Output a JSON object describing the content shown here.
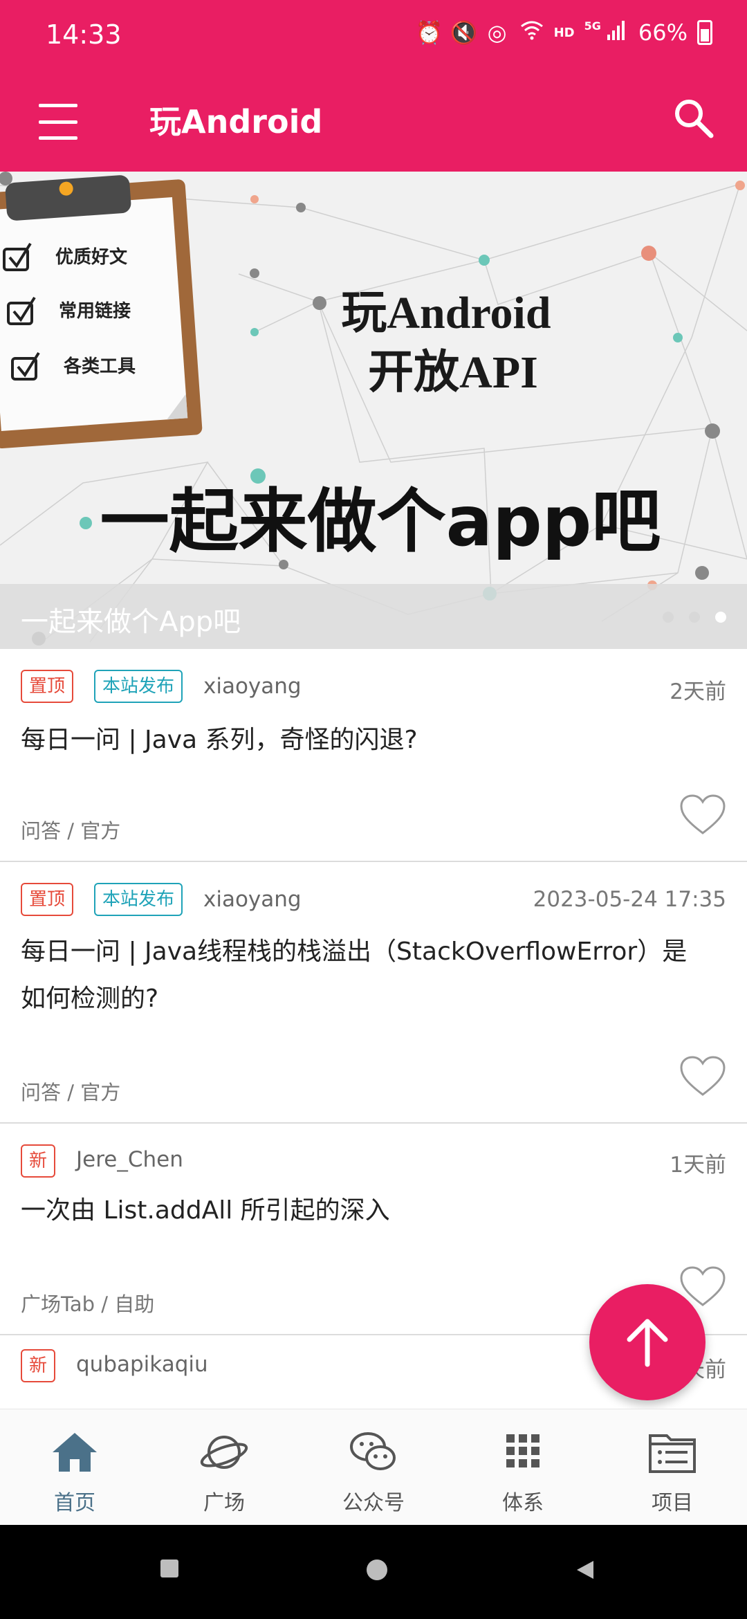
{
  "status_bar": {
    "time": "14:33",
    "battery": "66%",
    "network": "5G",
    "hd_label": "HD",
    "icons": [
      "alarm-icon",
      "mute-icon",
      "hotspot-icon",
      "wifi-icon",
      "signal-icon",
      "battery-icon"
    ]
  },
  "app_bar": {
    "title": "玩Android",
    "menu_icon": "menu-icon",
    "search_icon": "search-icon"
  },
  "banner": {
    "caption": "一起来做个App吧",
    "image_text": {
      "checklist": [
        "优质好文",
        "常用链接",
        "各类工具"
      ],
      "headline_line1": "玩Android",
      "headline_line2": "开放API",
      "slogan": "一起来做个app吧"
    },
    "dots_count": 3,
    "active_dot": 3
  },
  "articles": [
    {
      "tags": [
        "置顶",
        "本站发布"
      ],
      "author": "xiaoyang",
      "date": "2天前",
      "title": "每日一问 | Java 系列，奇怪的闪退?",
      "category": "问答 / 官方"
    },
    {
      "tags": [
        "置顶",
        "本站发布"
      ],
      "author": "xiaoyang",
      "date": "2023-05-24 17:35",
      "title": "每日一问 | Java线程栈的栈溢出（StackOverflowError）是如何检测的?",
      "category": "问答 / 官方"
    },
    {
      "tags": [
        "新"
      ],
      "author": "Jere_Chen",
      "date": "1天前",
      "title": "一次由 List.addAll 所引起的深入",
      "category": "广场Tab / 自助"
    },
    {
      "tags": [
        "新"
      ],
      "author": "qubapikaqiu",
      "date": "1天前",
      "title": "",
      "category": ""
    }
  ],
  "bottom_nav": [
    {
      "label": "首页",
      "icon": "home-icon",
      "active": true
    },
    {
      "label": "广场",
      "icon": "planet-icon",
      "active": false
    },
    {
      "label": "公众号",
      "icon": "wechat-icon",
      "active": false
    },
    {
      "label": "体系",
      "icon": "grid-icon",
      "active": false
    },
    {
      "label": "项目",
      "icon": "folder-list-icon",
      "active": false
    }
  ],
  "colors": {
    "primary": "#e91e63",
    "tag_red": "#e64a3a",
    "tag_cyan": "#1fa3b8",
    "nav_active": "#4b7189"
  }
}
